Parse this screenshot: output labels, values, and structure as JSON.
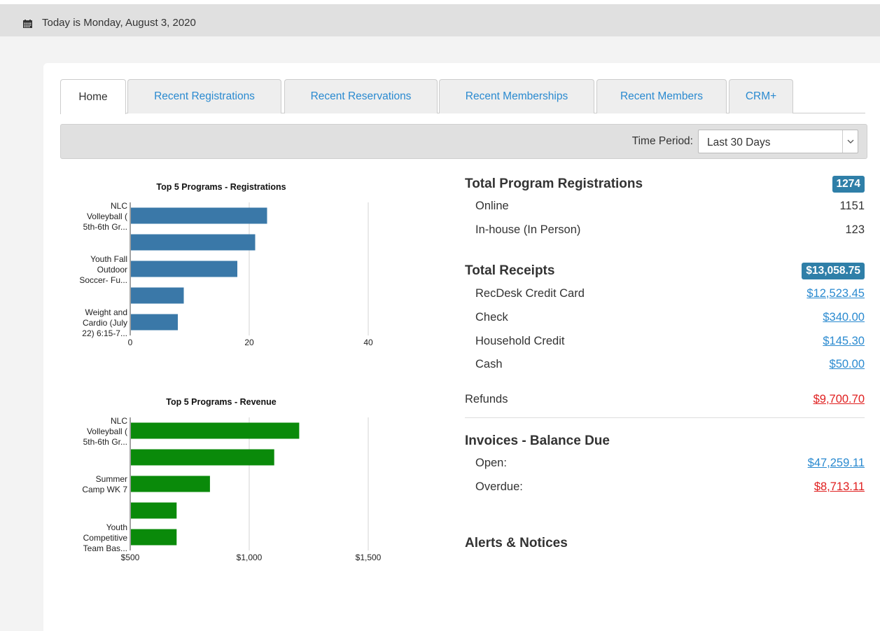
{
  "header": {
    "date_text": "Today is Monday, August 3, 2020",
    "icon": "calendar-icon"
  },
  "tabs": [
    {
      "label": "Home",
      "active": true
    },
    {
      "label": "Recent Registrations",
      "active": false
    },
    {
      "label": "Recent Reservations",
      "active": false
    },
    {
      "label": "Recent Memberships",
      "active": false
    },
    {
      "label": "Recent Members",
      "active": false
    },
    {
      "label": "CRM+",
      "active": false
    }
  ],
  "filter": {
    "label": "Time Period:",
    "selected": "Last 30 Days"
  },
  "chart_data": [
    {
      "type": "bar",
      "orientation": "horizontal",
      "title": "Top 5 Programs - Registrations",
      "category_labels": [
        [
          "NLC",
          "Volleyball (",
          "5th-6th Gr..."
        ],
        [
          "Youth Fall",
          "Outdoor",
          "Soccer- Fu..."
        ],
        [
          "Weight and",
          "Cardio (July",
          "22) 6:15-7..."
        ]
      ],
      "values": [
        23,
        21,
        18,
        9,
        8
      ],
      "xlim": [
        0,
        40
      ],
      "ticks": [
        0,
        20,
        40
      ],
      "tick_labels": [
        "0",
        "20",
        "40"
      ],
      "color": "#3a78a8",
      "grid": true
    },
    {
      "type": "bar",
      "orientation": "horizontal",
      "title": "Top 5 Programs - Revenue",
      "category_labels": [
        [
          "NLC",
          "Volleyball (",
          "5th-6th Gr..."
        ],
        [
          "Summer",
          "Camp WK 7"
        ],
        [
          "Youth",
          "Competitive",
          "Team Bas..."
        ]
      ],
      "values": [
        1210,
        1105,
        835,
        695,
        695
      ],
      "xlim": [
        500,
        1500
      ],
      "ticks": [
        500,
        1000,
        1500
      ],
      "tick_labels": [
        "$500",
        "$1,000",
        "$1,500"
      ],
      "color": "#0a8a0a",
      "grid": true
    }
  ],
  "stats": {
    "registrations": {
      "title": "Total Program Registrations",
      "total": "1274",
      "rows": [
        {
          "label": "Online",
          "value": "1151"
        },
        {
          "label": "In-house (In Person)",
          "value": "123"
        }
      ]
    },
    "receipts": {
      "title": "Total Receipts",
      "total": "$13,058.75",
      "rows": [
        {
          "label": "RecDesk Credit Card",
          "value": "$12,523.45"
        },
        {
          "label": "Check",
          "value": "$340.00"
        },
        {
          "label": "Household Credit",
          "value": "$145.30"
        },
        {
          "label": "Cash",
          "value": "$50.00"
        }
      ]
    },
    "refunds": {
      "label": "Refunds",
      "value": "$9,700.70"
    },
    "invoices": {
      "title": "Invoices - Balance Due",
      "rows": [
        {
          "label": "Open:",
          "value": "$47,259.11"
        },
        {
          "label": "Overdue:",
          "value": "$8,713.11"
        }
      ]
    },
    "alerts": {
      "title": "Alerts & Notices"
    }
  },
  "colors": {
    "link": "#2a8ad0",
    "negative": "#e02020",
    "badge": "#2f7fa8"
  }
}
